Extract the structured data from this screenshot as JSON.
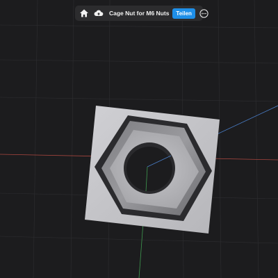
{
  "toolbar": {
    "home_icon": "home-icon",
    "cloud_icon": "cloud-upload-icon",
    "title": "Cage Nut for M6 Nuts",
    "share_label": "Teilen",
    "more_icon": "more-options-icon"
  },
  "colors": {
    "background": "#1c1c1e",
    "toolbar": "#2c2c2e",
    "accent": "#1e8fe8",
    "axis_x": "#a8463f",
    "axis_y": "#3f9a50",
    "axis_z": "#4a7ec8",
    "plate": "#c8c8cc"
  }
}
